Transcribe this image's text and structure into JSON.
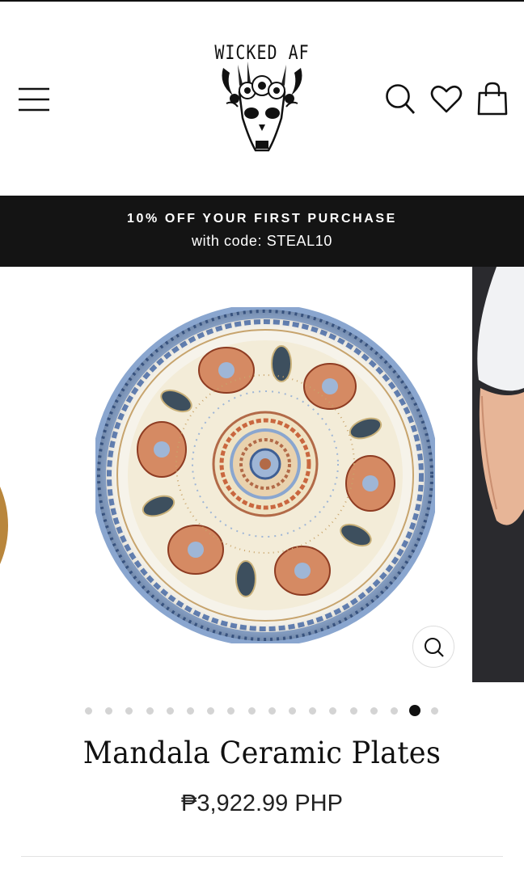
{
  "header": {
    "logo_text": "WICKED AF",
    "menu_icon": "hamburger-menu-icon",
    "search_icon": "search-icon",
    "wishlist_icon": "heart-icon",
    "cart_icon": "shopping-bag-icon"
  },
  "promo": {
    "title": "10% OFF YOUR FIRST PURCHASE",
    "subtitle": "with code: STEAL10"
  },
  "gallery": {
    "image_description": "mandala ceramic plate",
    "zoom_icon": "zoom-icon",
    "slide_count": 18,
    "active_slide": 16
  },
  "product": {
    "title": "Mandala Ceramic Plates",
    "price": "₱3,922.99 PHP"
  },
  "colors": {
    "promo_bg": "#141414",
    "text": "#111111",
    "plate_blue": "#7d9cc8",
    "plate_red": "#b45a3c"
  }
}
